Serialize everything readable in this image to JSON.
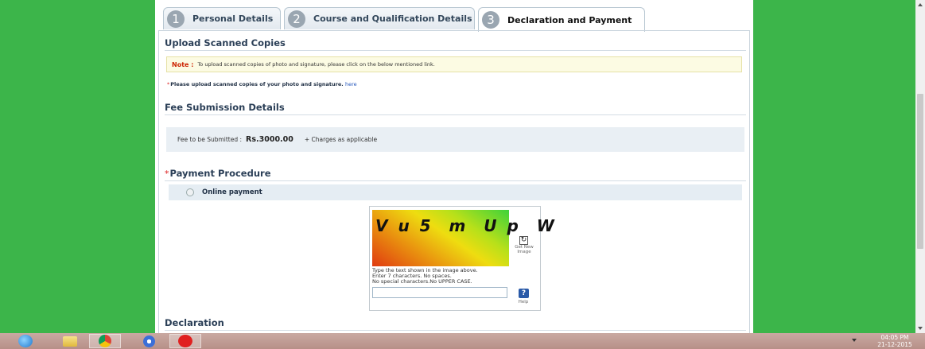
{
  "tabs": [
    {
      "number": "1",
      "label": "Personal Details"
    },
    {
      "number": "2",
      "label": "Course and Qualification Details"
    },
    {
      "number": "3",
      "label": "Declaration and Payment"
    }
  ],
  "upload": {
    "title": "Upload Scanned Copies",
    "note_label": "Note :",
    "note_text": "To upload scanned copies of photo and signature, please click on the below mentioned link.",
    "required_mark": "*",
    "instruction": "Please upload scanned copies of your photo and signature.",
    "link_text": "here"
  },
  "fee": {
    "title": "Fee Submission Details",
    "label": "Fee to be Submitted :",
    "amount": "Rs.3000.00",
    "charges": "+ Charges as applicable"
  },
  "payment": {
    "required_mark": "*",
    "title": "Payment Procedure",
    "option_label": "Online payment"
  },
  "captcha": {
    "image_text": "V u 5  m  U p  W",
    "refresh_label": "Get New Image",
    "instruction_line1": "Type the text shown in the image above.",
    "instruction_line2": "Enter 7 characters. No spaces.",
    "instruction_line3": "No special characters.No UPPER CASE.",
    "input_value": "",
    "help_glyph": "?",
    "help_label": "Help"
  },
  "declaration": {
    "title": "Declaration"
  },
  "taskbar": {
    "icons": [
      "internet-explorer-icon",
      "file-explorer-icon",
      "chrome-icon",
      "media-player-icon",
      "airtel-icon"
    ],
    "time": "04:05 PM",
    "date": "21-12-2015"
  }
}
